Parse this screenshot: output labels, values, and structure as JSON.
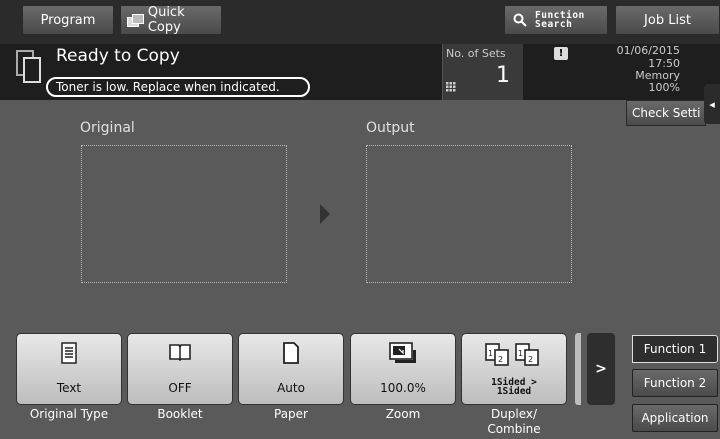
{
  "topbar": {
    "program": "Program",
    "quick_copy": "Quick Copy",
    "function_search_line1": "Function",
    "function_search_line2": "Search",
    "job_list": "Job List"
  },
  "status": {
    "title": "Ready to Copy",
    "message": "Toner is low. Replace when indicated.",
    "sets_label": "No. of Sets",
    "sets_value": "1",
    "alert_glyph": "!",
    "date": "01/06/2015",
    "time": "17:50",
    "memory_label": "Memory",
    "memory_value": "100%",
    "check_settings": "Check Setti",
    "side_tab_glyph": "◂"
  },
  "preview": {
    "original_label": "Original",
    "output_label": "Output"
  },
  "function_keys": [
    {
      "value": "Text",
      "label": "Original Type",
      "icon": "document-text-icon"
    },
    {
      "value": "OFF",
      "label": "Booklet",
      "icon": "booklet-icon"
    },
    {
      "value": "Auto",
      "label": "Paper",
      "icon": "paper-icon"
    },
    {
      "value": "100.0%",
      "label": "Zoom",
      "icon": "zoom-icon"
    },
    {
      "value_line1": "1Sided >",
      "value_line2": "1Sided",
      "label_line1": "Duplex/",
      "label_line2": "Combine",
      "icon": "duplex-icon"
    }
  ],
  "side_buttons": {
    "next_glyph": ">",
    "function1": "Function 1",
    "function2": "Function 2",
    "application": "Application"
  }
}
